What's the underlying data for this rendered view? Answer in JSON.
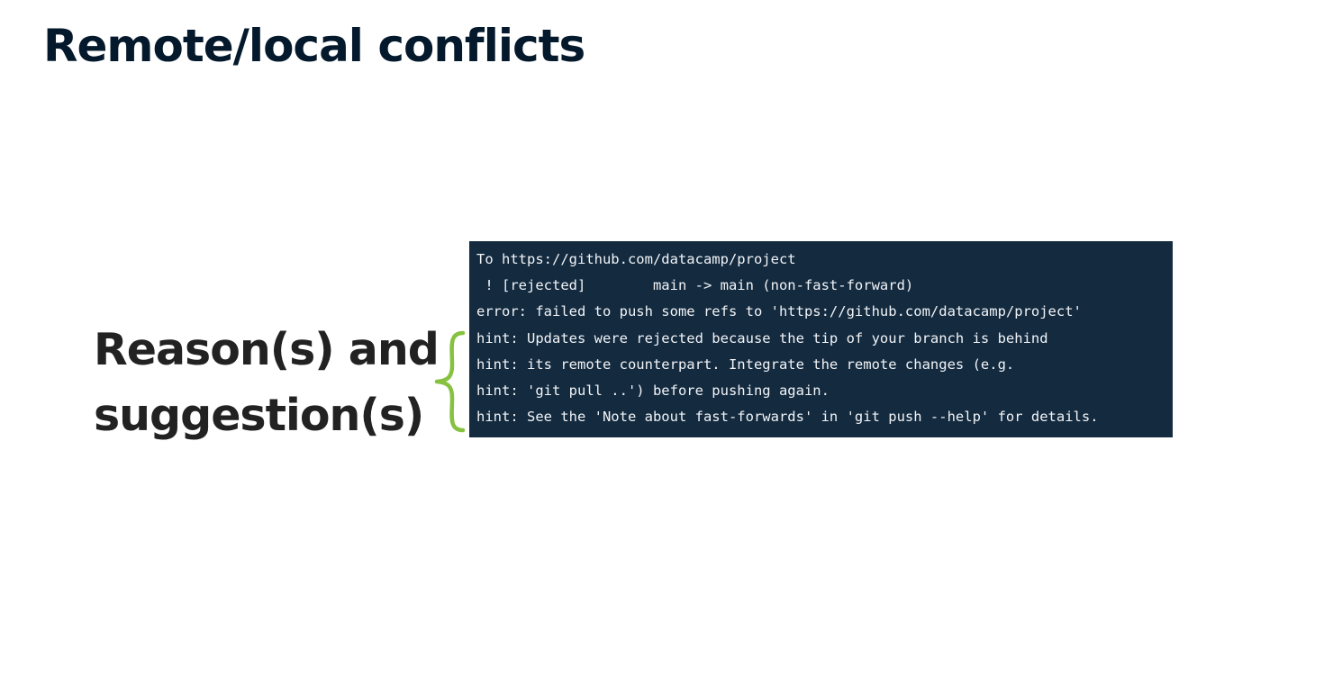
{
  "slide": {
    "title": "Remote/local conflicts"
  },
  "callout": {
    "label_line1": "Reason(s) and",
    "label_line2": "suggestion(s)",
    "brace_color": "#86c140",
    "brace_icon": "curly-brace-icon"
  },
  "terminal": {
    "background": "#132a3f",
    "lines": [
      "To https://github.com/datacamp/project",
      " ! [rejected]        main -> main (non-fast-forward)",
      "error: failed to push some refs to 'https://github.com/datacamp/project'",
      "hint: Updates were rejected because the tip of your branch is behind",
      "hint: its remote counterpart. Integrate the remote changes (e.g.",
      "hint: 'git pull ..') before pushing again.",
      "hint: See the 'Note about fast-forwards' in 'git push --help' for details."
    ]
  }
}
